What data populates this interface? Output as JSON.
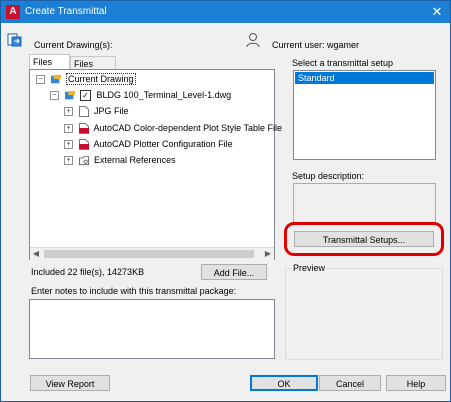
{
  "window": {
    "title": "Create Transmittal",
    "close_glyph": "✕"
  },
  "header": {
    "current_drawings_label": "Current Drawing(s):",
    "current_user_label": "Current user: wgamer"
  },
  "tabs": [
    {
      "label": "Files Tree",
      "active": true
    },
    {
      "label": "Files Table",
      "active": false
    }
  ],
  "tree": {
    "root": "Current Drawing",
    "drawing": "BLDG 100_Terminal_Level-1.dwg",
    "children": [
      {
        "label": "JPG File",
        "icon": "jpg-file-icon"
      },
      {
        "label": "AutoCAD Color-dependent Plot Style Table File",
        "icon": "ctb-file-icon"
      },
      {
        "label": "AutoCAD Plotter Configuration File",
        "icon": "pc3-file-icon"
      },
      {
        "label": "External References",
        "icon": "xref-folder-icon"
      }
    ],
    "expander_glyph": "+",
    "collapse_glyph": "−",
    "check_glyph": "✓"
  },
  "summary": {
    "included_text": "Included 22 file(s), 14273KB",
    "add_file_label": "Add File..."
  },
  "notes": {
    "label": "Enter notes to include with this transmittal package:",
    "value": ""
  },
  "setup": {
    "select_label": "Select a transmittal setup",
    "options": [
      "Standard"
    ],
    "selected": "Standard",
    "description_label": "Setup description:",
    "description_value": "",
    "transmittal_setups_button": "Transmittal Setups...",
    "preview_label": "Preview"
  },
  "footer": {
    "view_report": "View Report",
    "ok": "OK",
    "cancel": "Cancel",
    "help": "Help"
  },
  "colors": {
    "titlebar": "#1b7fd6",
    "selection": "#0078d7",
    "highlight_ring": "#e00000"
  }
}
